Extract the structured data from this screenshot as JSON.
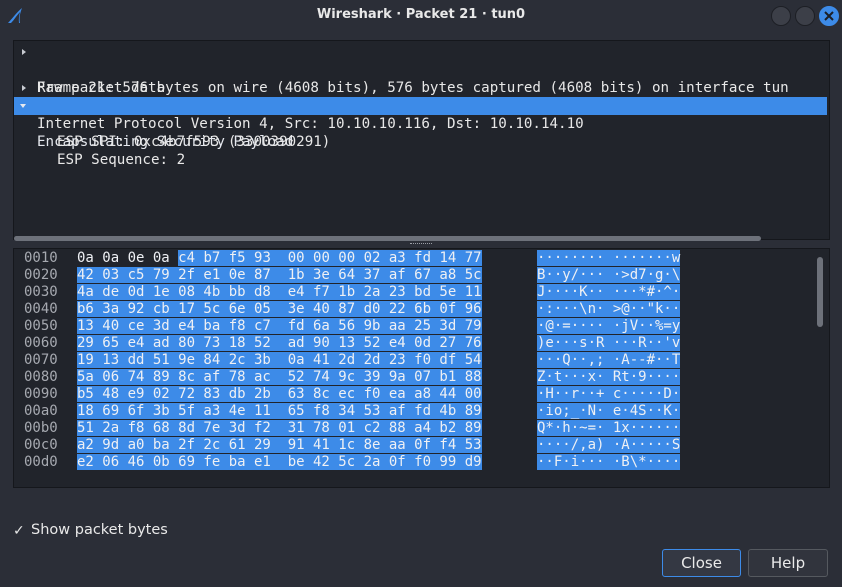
{
  "window": {
    "title": "Wireshark · Packet 21 · tun0"
  },
  "tree": {
    "rows": [
      {
        "text": "Frame 21: 576 bytes on wire (4608 bits), 576 bytes captured (4608 bits) on interface tun",
        "expandable": true,
        "indent": 0
      },
      {
        "text": "Raw packet data",
        "expandable": false,
        "indent": 0
      },
      {
        "text": "Internet Protocol Version 4, Src: 10.10.10.116, Dst: 10.10.14.10",
        "expandable": true,
        "indent": 0
      },
      {
        "text": "Encapsulating Security Payload",
        "expandable": true,
        "expanded": true,
        "indent": 0,
        "selected": true
      },
      {
        "text": "ESP SPI: 0xc4b7f593 (3300390291)",
        "expandable": false,
        "indent": 1
      },
      {
        "text": "ESP Sequence: 2",
        "expandable": false,
        "indent": 1
      }
    ]
  },
  "hex": {
    "rows": [
      {
        "offset": "0010",
        "pre": "0a 0a 0e 0a ",
        "sel": "c4 b7 f5 93  00 00 00 02 a3 fd 14 77",
        "ascii_pre": "",
        "ascii_sel": "········ ·······w"
      },
      {
        "offset": "0020",
        "pre": "",
        "sel": "42 03 c5 79 2f e1 0e 87  1b 3e 64 37 af 67 a8 5c",
        "ascii_pre": "",
        "ascii_sel": "B··y/··· ·>d7·g·\\"
      },
      {
        "offset": "0030",
        "pre": "",
        "sel": "4a de 0d 1e 08 4b bb d8  e4 f7 1b 2a 23 bd 5e 11",
        "ascii_pre": "",
        "ascii_sel": "J····K·· ···*#·^·"
      },
      {
        "offset": "0040",
        "pre": "",
        "sel": "b6 3a 92 cb 17 5c 6e 05  3e 40 87 d0 22 6b 0f 96",
        "ascii_pre": "",
        "ascii_sel": "·:···\\n· >@··\"k··"
      },
      {
        "offset": "0050",
        "pre": "",
        "sel": "13 40 ce 3d e4 ba f8 c7  fd 6a 56 9b aa 25 3d 79",
        "ascii_pre": "",
        "ascii_sel": "·@·=···· ·jV··%=y"
      },
      {
        "offset": "0060",
        "pre": "",
        "sel": "29 65 e4 ad 80 73 18 52  ad 90 13 52 e4 0d 27 76",
        "ascii_pre": "",
        "ascii_sel": ")e···s·R ···R··'v"
      },
      {
        "offset": "0070",
        "pre": "",
        "sel": "19 13 dd 51 9e 84 2c 3b  0a 41 2d 2d 23 f0 df 54",
        "ascii_pre": "",
        "ascii_sel": "···Q··,; ·A--#··T"
      },
      {
        "offset": "0080",
        "pre": "",
        "sel": "5a 06 74 89 8c af 78 ac  52 74 9c 39 9a 07 b1 88",
        "ascii_pre": "",
        "ascii_sel": "Z·t···x· Rt·9····"
      },
      {
        "offset": "0090",
        "pre": "",
        "sel": "b5 48 e9 02 72 83 db 2b  63 8c ec f0 ea a8 44 00",
        "ascii_pre": "",
        "ascii_sel": "·H··r··+ c·····D·"
      },
      {
        "offset": "00a0",
        "pre": "",
        "sel": "18 69 6f 3b 5f a3 4e 11  65 f8 34 53 af fd 4b 89",
        "ascii_pre": "",
        "ascii_sel": "·io;_·N· e·4S··K·"
      },
      {
        "offset": "00b0",
        "pre": "",
        "sel": "51 2a f8 68 8d 7e 3d f2  31 78 01 c2 88 a4 b2 89",
        "ascii_pre": "",
        "ascii_sel": "Q*·h·~=· 1x······"
      },
      {
        "offset": "00c0",
        "pre": "",
        "sel": "a2 9d a0 ba 2f 2c 61 29  91 41 1c 8e aa 0f f4 53",
        "ascii_pre": "",
        "ascii_sel": "····/,a) ·A·····S"
      },
      {
        "offset": "00d0",
        "pre": "",
        "sel": "e2 06 46 0b 69 fe ba e1  be 42 5c 2a 0f f0 99 d9",
        "ascii_pre": "",
        "ascii_sel": "··F·i··· ·B\\*····"
      }
    ]
  },
  "footer": {
    "show_bytes_label": "Show packet bytes",
    "show_bytes_checked": true,
    "checkmark": "✓",
    "close_label": "Close",
    "help_label": "Help"
  },
  "colors": {
    "accent": "#3d8be8",
    "background": "#2b2e37",
    "pane": "#21242b"
  },
  "icons": [
    "wireshark-fin-icon",
    "minimize-icon",
    "maximize-icon",
    "close-icon",
    "expand-arrow-icon",
    "collapse-arrow-icon",
    "checkmark-icon"
  ]
}
